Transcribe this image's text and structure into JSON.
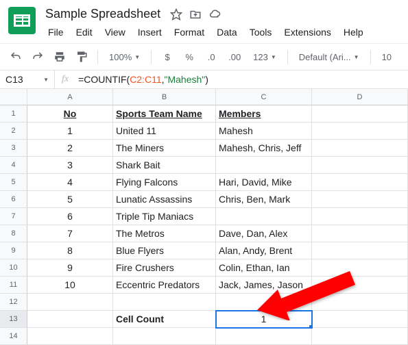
{
  "doc_title": "Sample Spreadsheet",
  "menu": [
    "File",
    "Edit",
    "View",
    "Insert",
    "Format",
    "Data",
    "Tools",
    "Extensions",
    "Help"
  ],
  "toolbar": {
    "zoom": "100%",
    "num_format": "123",
    "font": "Default (Ari...",
    "font_size": "10"
  },
  "name_box": "C13",
  "formula": {
    "prefix": "=",
    "fn": "COUNTIF",
    "open": "(",
    "range": "C2:C11",
    "comma": ",",
    "str": "\"Mahesh\"",
    "close": ")"
  },
  "column_headers": [
    "A",
    "B",
    "C",
    "D"
  ],
  "rows": [
    {
      "n": "1",
      "a": "No",
      "b": "Sports Team Name",
      "c": "Members",
      "d": "",
      "hdr": true
    },
    {
      "n": "2",
      "a": "1",
      "b": "United 11",
      "c": "Mahesh",
      "d": ""
    },
    {
      "n": "3",
      "a": "2",
      "b": "The Miners",
      "c": "Mahesh, Chris, Jeff",
      "d": ""
    },
    {
      "n": "4",
      "a": "3",
      "b": "Shark Bait",
      "c": "",
      "d": ""
    },
    {
      "n": "5",
      "a": "4",
      "b": "Flying Falcons",
      "c": "Hari, David, Mike",
      "d": ""
    },
    {
      "n": "6",
      "a": "5",
      "b": "Lunatic Assassins",
      "c": "Chris, Ben, Mark",
      "d": ""
    },
    {
      "n": "7",
      "a": "6",
      "b": "Triple Tip Maniacs",
      "c": "",
      "d": ""
    },
    {
      "n": "8",
      "a": "7",
      "b": "The Metros",
      "c": "Dave, Dan, Alex",
      "d": ""
    },
    {
      "n": "9",
      "a": "8",
      "b": "Blue Flyers",
      "c": "Alan, Andy, Brent",
      "d": ""
    },
    {
      "n": "10",
      "a": "9",
      "b": "Fire Crushers",
      "c": "Colin, Ethan, Ian",
      "d": ""
    },
    {
      "n": "11",
      "a": "10",
      "b": "Eccentric Predators",
      "c": "Jack, James, Jason",
      "d": ""
    },
    {
      "n": "12",
      "a": "",
      "b": "",
      "c": "",
      "d": ""
    },
    {
      "n": "13",
      "a": "",
      "b": "Cell Count",
      "c": "1",
      "d": "",
      "sel": true,
      "bbold": true
    },
    {
      "n": "14",
      "a": "",
      "b": "",
      "c": "",
      "d": ""
    }
  ]
}
